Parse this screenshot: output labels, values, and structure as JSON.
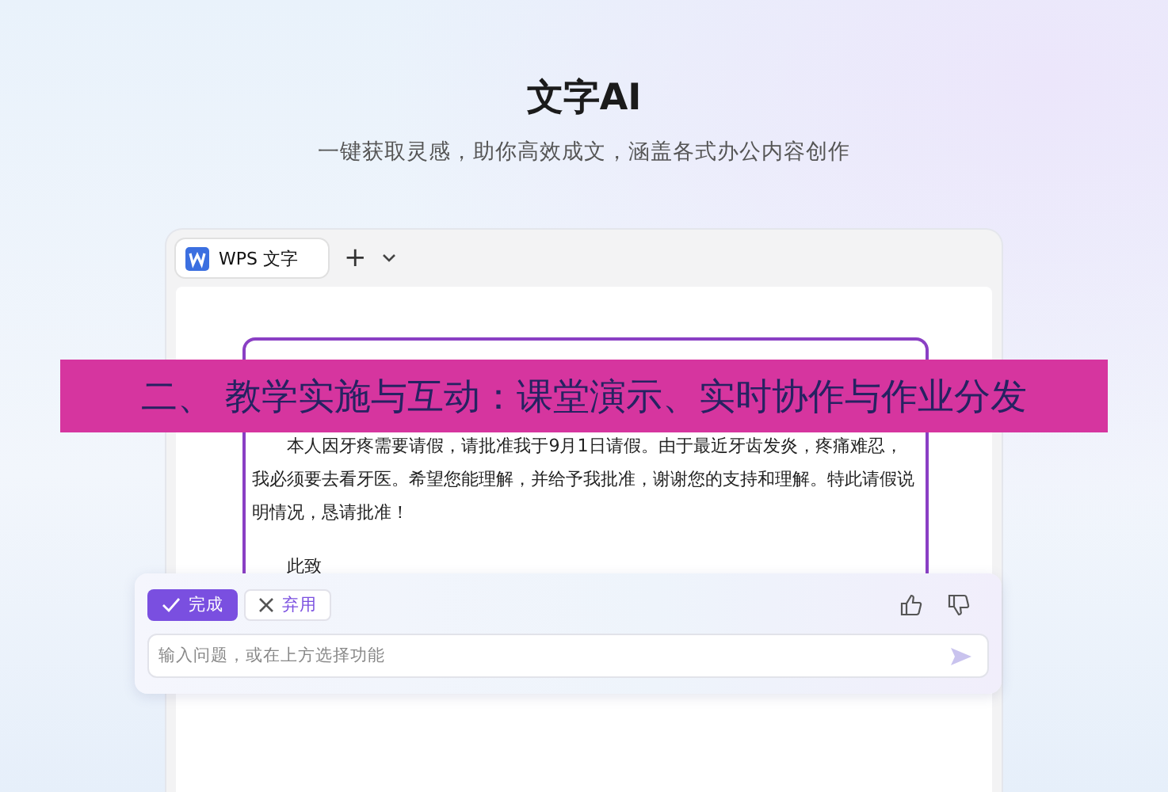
{
  "header": {
    "title": "文字AI",
    "subtitle": "一键获取灵感，助你高效成文，涵盖各式办公内容创作"
  },
  "window": {
    "tab": {
      "label": "WPS 文字",
      "selected": true
    },
    "new_tab": "+"
  },
  "document": {
    "paragraphs": [
      "本人因牙疼需要请假，请批准我于9月1日请假。由于最近牙齿发炎，疼痛难忍，我必须要去看牙医。希望您能理解，并给予我批准，谢谢您的支持和理解。特此请假说明情况，恳请批准！",
      "此致"
    ]
  },
  "ai_panel": {
    "buttons": [
      {
        "label": "完成",
        "kind": "primary"
      },
      {
        "label": "弃用",
        "kind": "secondary"
      }
    ],
    "input": {
      "placeholder": "输入问题，或在上方选择功能"
    }
  },
  "banner": {
    "text": "二、 教学实施与互动：课堂演示、实时协作与作业分发"
  }
}
